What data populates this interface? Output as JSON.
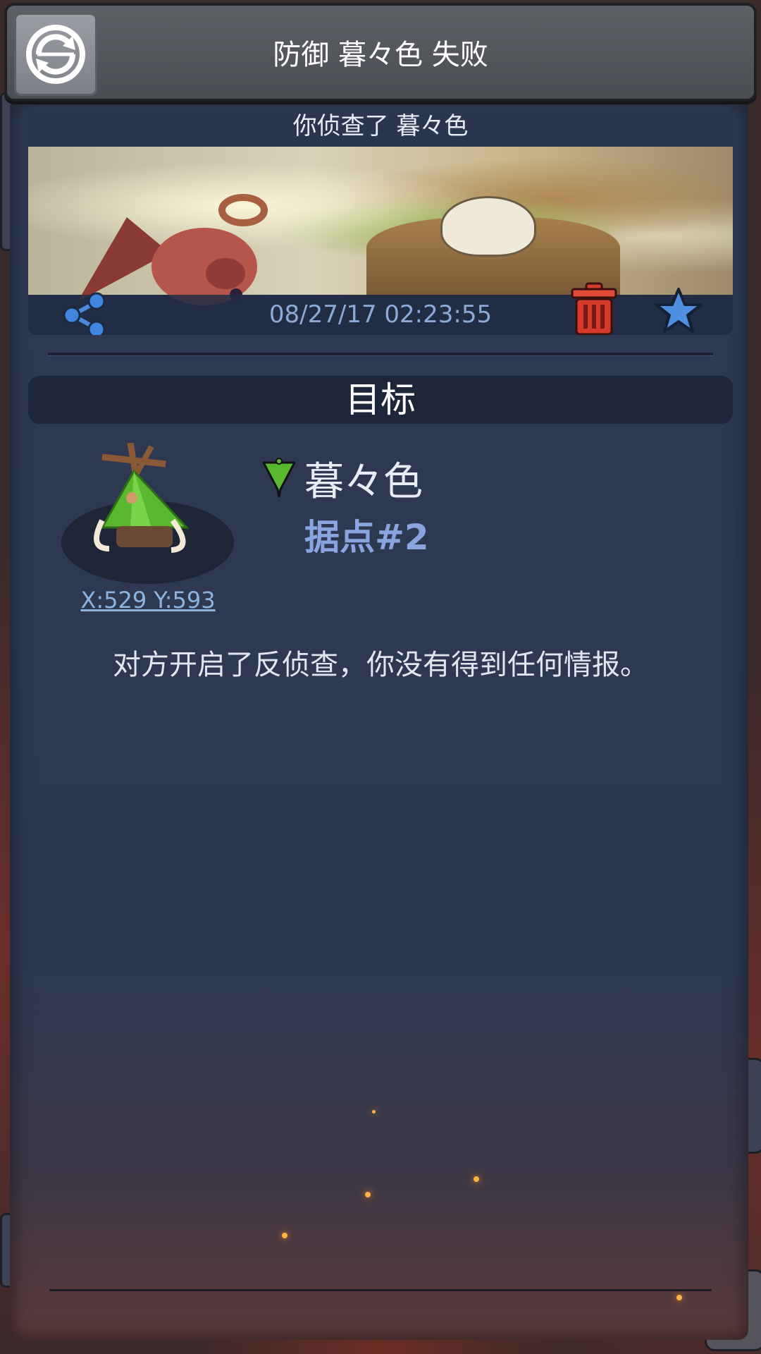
{
  "header": {
    "title": "防御 暮々色 失败"
  },
  "report": {
    "banner_title": "你侦查了 暮々色",
    "timestamp": "08/27/17 02:23:55"
  },
  "section": {
    "title": "目标"
  },
  "target": {
    "coordinates": "X:529 Y:593",
    "player_name": "暮々色",
    "stronghold": "据点#2"
  },
  "message": "对方开启了反侦查，你没有得到任何情报。",
  "icons": {
    "header": "refresh-icon",
    "share": "share-icon",
    "delete": "trash-icon",
    "favorite": "star-icon",
    "alliance": "flag-icon",
    "target": "hut-icon"
  },
  "colors": {
    "panel": "#2f3a52",
    "accent_blue": "#8aa4e0",
    "trash_red": "#d63a2c",
    "flag_green": "#5ab82e"
  }
}
